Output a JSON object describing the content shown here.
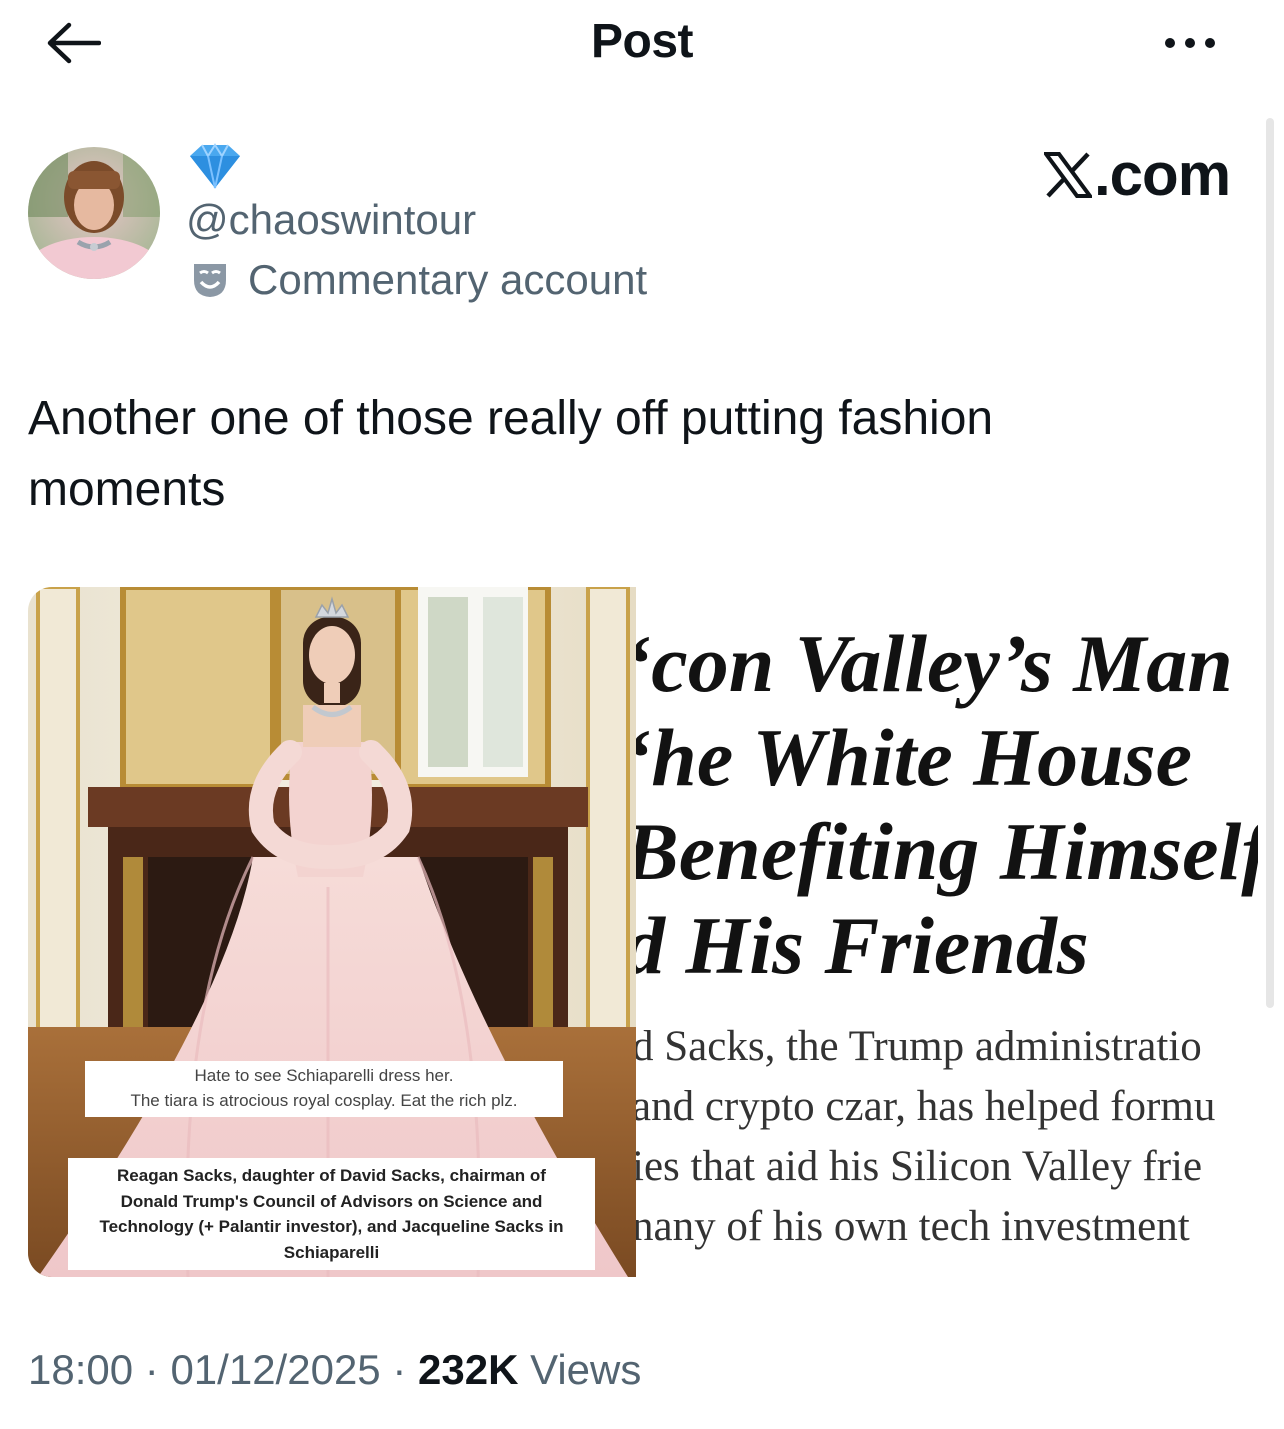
{
  "header": {
    "title": "Post",
    "back_icon": "arrow-left-icon",
    "more_icon": "more-horizontal-icon"
  },
  "author": {
    "handle": "@chaoswintour",
    "account_label": "Commentary account",
    "badge_icon": "diamond-icon",
    "label_icon": "theater-mask-icon"
  },
  "brand": {
    "label": ".com",
    "icon": "x-logo-icon"
  },
  "post": {
    "text": "Another one of those really off putting fashion moments"
  },
  "media": {
    "left_caption_1_line_1": "Hate to see Schiaparelli dress her.",
    "left_caption_1_line_2": "The tiara is atrocious royal cosplay. Eat the rich plz.",
    "left_caption_2_line_1": "Reagan Sacks, daughter of David Sacks, chairman of",
    "left_caption_2_line_2": "Donald Trump's Council of Advisors on Science and",
    "left_caption_2_line_3": "Technology (+ Palantir investor), and Jacqueline Sacks in",
    "left_caption_2_line_4": "Schiaparelli",
    "headline_lines": [
      "‘con Valley’s Man",
      "‘he White House",
      "Benefiting Himself",
      "d His Friends"
    ],
    "deck_lines": [
      "d Sacks, the Trump administratio",
      "and crypto czar, has helped formu",
      "ies that aid his Silicon Valley frie",
      "nany of his own tech investment"
    ]
  },
  "meta": {
    "time": "18:00",
    "separator": "·",
    "date": "01/12/2025",
    "views_count": "232K",
    "views_label": "Views"
  },
  "colors": {
    "text_primary": "#0f1419",
    "text_secondary": "#536471",
    "gown_pink": "#f3d3d3",
    "gilded_gold": "#c9a24a"
  }
}
